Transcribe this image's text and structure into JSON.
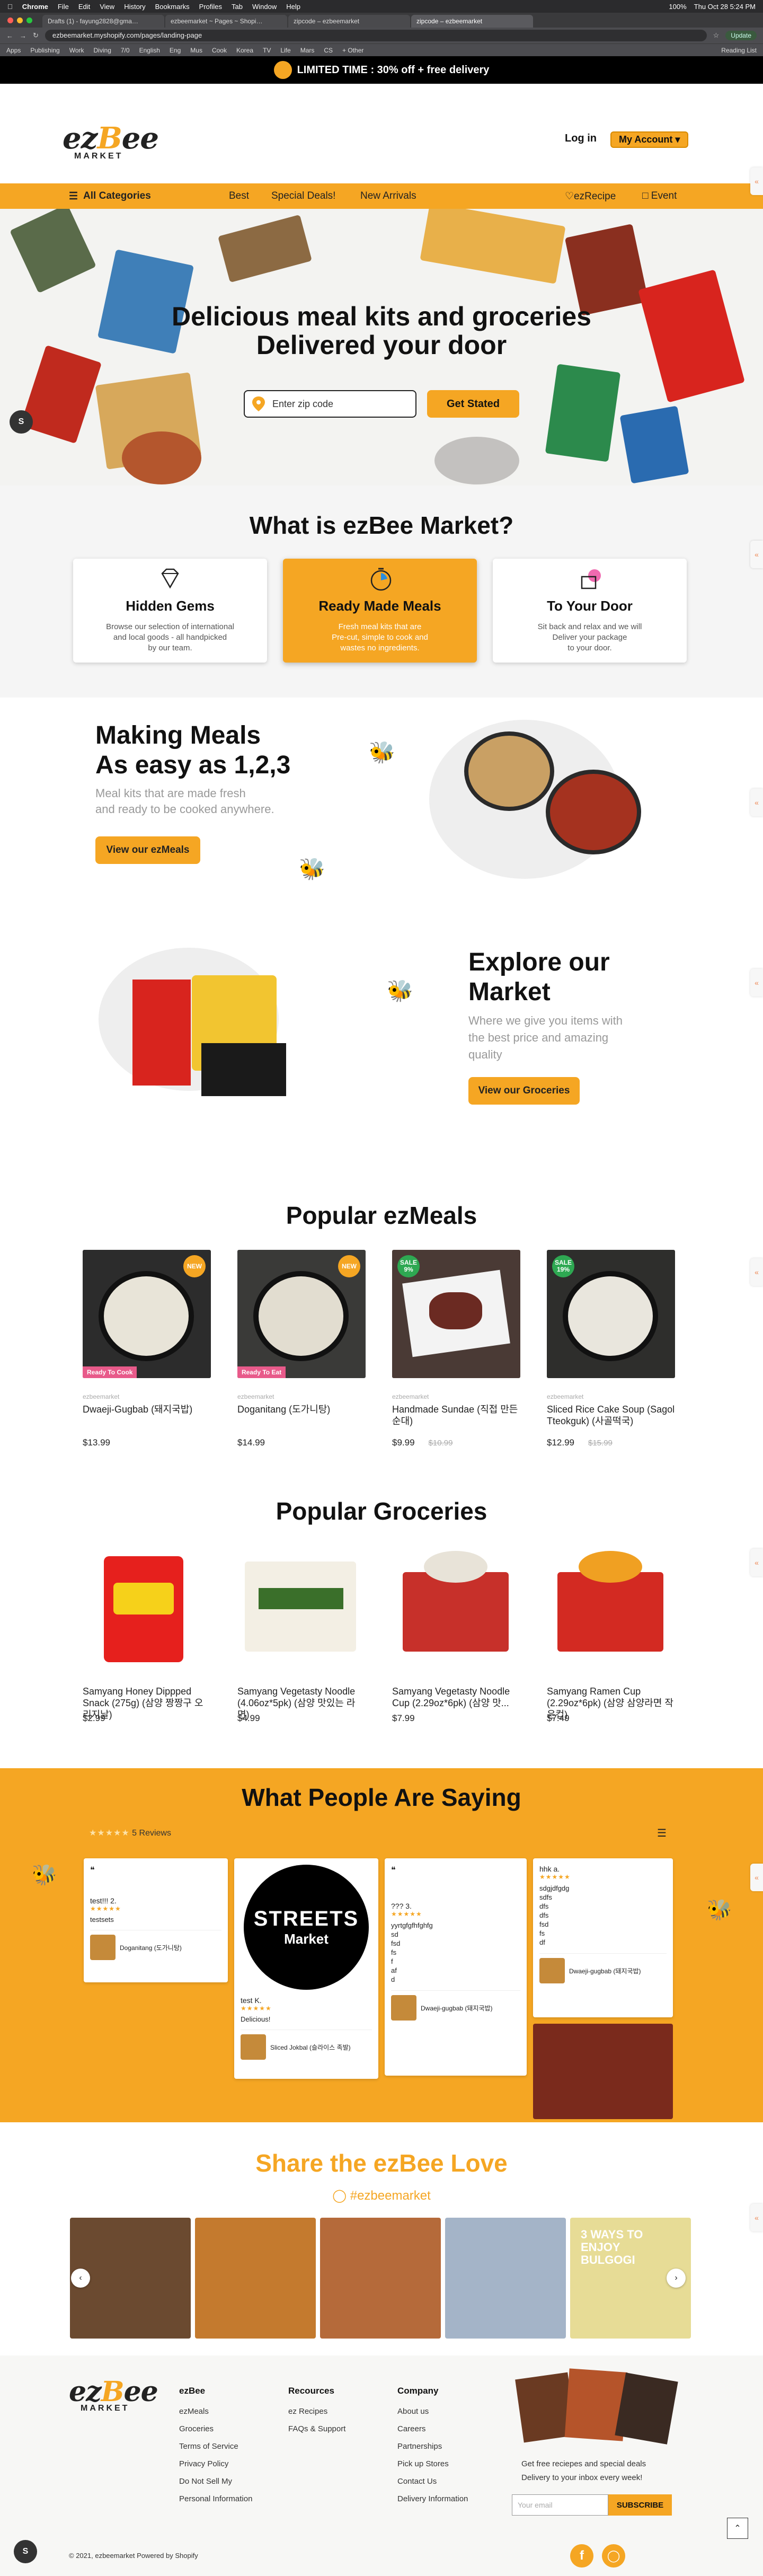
{
  "mac": {
    "app": "Chrome",
    "menus": [
      "File",
      "Edit",
      "View",
      "History",
      "Bookmarks",
      "Profiles",
      "Tab",
      "Window",
      "Help"
    ],
    "battery": "100%",
    "datetime": "Thu Oct 28  5:24 PM"
  },
  "tabs": [
    "Drafts (1) - fayung2828@gma…",
    "ezbeemarket ~ Pages ~ Shopi…",
    "zipcode – ezbeemarket",
    "zipcode – ezbeemarket"
  ],
  "address": {
    "url": "ezbeemarket.myshopify.com/pages/landing-page",
    "update": "Update"
  },
  "bookmarks": [
    "Apps",
    "Publishing",
    "Work",
    "Diving",
    "7/0",
    "English",
    "Eng",
    "Mus",
    "Cook",
    "Korea",
    "TV",
    "Life",
    "Mars",
    "CS",
    "+ Other"
  ],
  "reading_list": "Reading List",
  "promo": "LIMITED TIME : 30% off + free delivery",
  "header": {
    "logo_main_left": "ez",
    "logo_b": "B",
    "logo_main_right": "ee",
    "logo_sub": "MARKET",
    "login": "Log in",
    "account": "My Account"
  },
  "nav": {
    "all": "All Categories",
    "best": "Best",
    "special": "Special Deals!",
    "new": "New Arrivals",
    "recipe": "ezRecipe",
    "event": "Event"
  },
  "hero": {
    "line1": "Delicious meal kits and groceries",
    "line2": "Delivered your door",
    "zip_placeholder": "Enter zip code",
    "cta": "Get Stated"
  },
  "what": {
    "title": "What is ezBee Market?",
    "cards": [
      {
        "title": "Hidden Gems",
        "l1": "Browse our selection of international",
        "l2": "and local goods - all handpicked",
        "l3": "by our team."
      },
      {
        "title": "Ready Made Meals",
        "l1": "Fresh meal kits that are",
        "l2": "Pre-cut, simple to cook and",
        "l3": "wastes no ingredients."
      },
      {
        "title": "To Your Door",
        "l1": "Sit back and relax and we will",
        "l2": "Deliver your package",
        "l3": "to your door."
      }
    ]
  },
  "making": {
    "line1": "Making Meals",
    "line2": "As easy as 1,2,3",
    "sub1": "Meal kits that are made fresh",
    "sub2": "and ready to be cooked anywhere.",
    "button": "View our ezMeals"
  },
  "explore": {
    "line1": "Explore our",
    "line2": "Market",
    "sub1": "Where we give you items with",
    "sub2": "the best price and amazing",
    "sub3": "quality",
    "button": "View our Groceries"
  },
  "meals": {
    "title": "Popular ezMeals",
    "items": [
      {
        "vendor": "ezbeemarket",
        "name": "Dwaeji-Gugbab (돼지국밥)",
        "price": "$13.99",
        "old": "",
        "badge": "NEW",
        "tag": "Ready To Cook"
      },
      {
        "vendor": "ezbeemarket",
        "name": "Doganitang (도가니탕)",
        "price": "$14.99",
        "old": "",
        "badge": "NEW",
        "tag": "Ready To Eat"
      },
      {
        "vendor": "ezbeemarket",
        "name": "Handmade Sundae (직접 만든 순대)",
        "price": "$9.99",
        "old": "$10.99",
        "badge": "SALE 9%",
        "tag": ""
      },
      {
        "vendor": "ezbeemarket",
        "name": "Sliced Rice Cake Soup (Sagol Tteokguk) (사골떡국)",
        "price": "$12.99",
        "old": "$15.99",
        "badge": "SALE 19%",
        "tag": ""
      }
    ]
  },
  "groceries": {
    "title": "Popular Groceries",
    "items": [
      {
        "vendor": "ezbeemarket",
        "name": "Samyang Honey Dippped Snack (275g) (삼양 짱짱구 오리지날)",
        "price": "$2.99"
      },
      {
        "vendor": "ezbeemarket",
        "name": "Samyang Vegetasty Noodle (4.06oz*5pk) (삼양 맛있는 라면)",
        "price": "$4.99"
      },
      {
        "vendor": "ezbeemarket",
        "name": "Samyang Vegetasty Noodle Cup (2.29oz*6pk) (삼양 맛...",
        "price": "$7.99"
      },
      {
        "vendor": "ezbeemarket",
        "name": "Samyang Ramen Cup (2.29oz*6pk) (삼양 삼양라면 작은컵)",
        "price": "$7.49"
      }
    ]
  },
  "reviews": {
    "title": "What People Are Saying",
    "count": "5 Reviews",
    "r1": {
      "name": "test!!! 2.",
      "body": "testsets",
      "product": "Doganitang (도가니탕)"
    },
    "r2": {
      "logo1": "STREETS",
      "logo2": "Market",
      "name": "test K.",
      "body": "Delicious!",
      "product": "Sliced Jokbal (슬라이스 족발)"
    },
    "r3": {
      "name": "??? 3.",
      "body": [
        "yyrtgfgfhfghfg",
        "sd",
        "fsd",
        "fs",
        "f",
        "af",
        "d"
      ],
      "product": "Dwaeji-gugbab (돼지국밥)"
    },
    "r4": {
      "name": "hhk a.",
      "body": [
        "sdgjdfgdg",
        "sdfs",
        "dfs",
        "dfs",
        "fsd",
        "fs",
        "df"
      ],
      "product": "Dwaeji-gugbab (돼지국밥)"
    }
  },
  "share": {
    "title": "Share the ezBee Love",
    "tag": "#ezbeemarket",
    "bulgogi": "3 WAYS TO ENJOY BULGOGI"
  },
  "footer": {
    "col1": {
      "title": "ezBee",
      "items": [
        "ezMeals",
        "Groceries",
        "Terms of Service",
        "Privacy Policy",
        "Do Not Sell My",
        "Personal Information"
      ]
    },
    "col2": {
      "title": "Recources",
      "items": [
        "ez Recipes",
        "FAQs & Support"
      ]
    },
    "col3": {
      "title": "Company",
      "items": [
        "About us",
        "Careers",
        "Partnerships",
        "Pick up Stores",
        "Contact Us",
        "Delivery Information"
      ]
    },
    "newsletter": {
      "l1": "Get free reciepes and special deals",
      "l2": "Delivery to your inbox every week!",
      "placeholder": "Your email",
      "button": "SUBSCRIBE"
    },
    "copyright": "© 2021, ezbeemarket Powered by Shopify"
  },
  "colors": {
    "accent": "#f5a623",
    "promo_bg": "#000000",
    "sale": "#e85a8a"
  }
}
